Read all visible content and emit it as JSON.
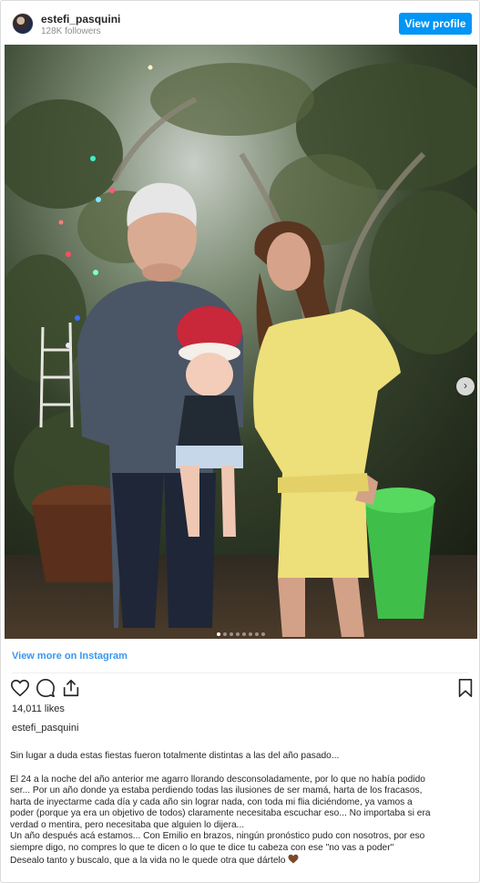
{
  "header": {
    "username": "estefi_pasquini",
    "followers": "128K followers",
    "view_profile_label": "View profile"
  },
  "post": {
    "carousel": {
      "total_slides": 8,
      "active_index": 0
    },
    "view_more_label": "View more on Instagram",
    "likes": "14,011 likes",
    "caption_username": "estefi_pasquini",
    "caption": {
      "p1": "Sin lugar a duda estas fiestas fueron totalmente distintas a las del año pasado...",
      "p2_l1": "El 24 a la noche del año anterior me agarro llorando desconsoladamente, por lo que no había podido",
      "p2_l2": "ser... Por un año donde ya estaba perdiendo todas las ilusiones de ser mamá, harta de los fracasos,",
      "p2_l3": "harta de inyectarme cada día y cada año sin lograr nada, con toda mi flia diciéndome, ya vamos a",
      "p2_l4": "poder (porque ya era un objetivo de todos) claramente necesitaba escuchar eso... No importaba si era",
      "p2_l5": "verdad o mentira, pero necesitaba que alguien lo dijera...",
      "p3_l1": "Un año después acá estamos... Con Emilio en brazos, ningún pronóstico pudo con nosotros, por eso",
      "p3_l2": "siempre digo, no compres lo que te dicen o lo que te dice tu cabeza con ese \"no vas a poder\"",
      "p3_l3": "Desealo tanto y buscalo, que a la vida no le quede otra que dártelo"
    }
  },
  "icons": {
    "avatar": "avatar",
    "like": "heart-icon",
    "comment": "comment-icon",
    "share": "share-icon",
    "save": "bookmark-icon",
    "next": "chevron-right-icon",
    "emoji": "brown-heart-icon"
  },
  "colors": {
    "primary_button": "#0095f6",
    "link": "#3897f0",
    "text": "#262626",
    "muted": "#8e8e8e",
    "brown_heart": "#7b4a2a"
  }
}
